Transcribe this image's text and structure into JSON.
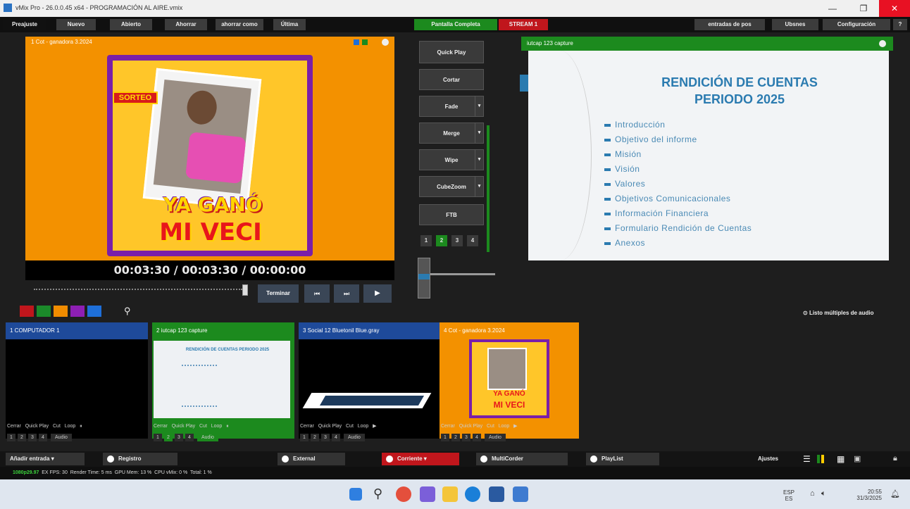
{
  "window": {
    "title": "vMix Pro - 26.0.0.45 x64 - PROGRAMACIÓN AL AIRE.vmix",
    "minimize": "—",
    "maximize": "❐",
    "close": "✕"
  },
  "menu": {
    "items": [
      "Preajuste",
      "Nuevo",
      "Abierto",
      "Ahorrar",
      "ahorrar como",
      "Última"
    ],
    "output_label": "Pantalla Completa",
    "stream_label": "STREAM 1",
    "right_items": [
      "entradas de pos",
      "Ubsnes",
      "Configuración",
      "?"
    ]
  },
  "preview": {
    "title": "1   Cot - ganadora 3.2024",
    "time": "00:03:30 / 00:03:30 / 00:00:00",
    "artwork_text": [
      "YA GANÓ",
      "MI VECI"
    ],
    "sorteo": "SORTEO",
    "play_label": "Terminar",
    "buttons": [
      "⏮",
      "⏭",
      "▶"
    ]
  },
  "transitions": {
    "quick_play": "Quick Play",
    "cut": "Cortar",
    "buttons": [
      "Fade",
      "Merge",
      "Wipe",
      "CubeZoom",
      "FTB"
    ],
    "numbers": [
      "1",
      "2",
      "3",
      "4"
    ]
  },
  "output": {
    "title": "iutcap 123 capture",
    "slide_title": [
      "RENDICIÓN DE CUENTAS",
      "PERIODO 2025"
    ],
    "bullets": [
      "Introducción",
      "Objetivo del informe",
      "Misión",
      "Visión",
      "Valores",
      "Objetivos Comunicacionales",
      "Información Financiera",
      "Formulario Rendición de Cuentas",
      "Anexos"
    ]
  },
  "audio_label": "Listo múltiples de audio",
  "colors": {
    "red": "#c0161c",
    "green": "#1b8a2a",
    "orange": "#f08c00",
    "purple": "#8e1fb4",
    "blue": "#1e6fd9",
    "accent_green": "#1c8a1e",
    "accent_orange": "#f39100",
    "blue_header": "#1e4a9a"
  },
  "inputs": [
    {
      "title": "1   COMPUTADOR 1",
      "controls": [
        "Cerrar",
        "Quick Play",
        "Cut",
        "Loop",
        "⏸"
      ],
      "numbers": [
        "1",
        "2",
        "3",
        "4"
      ],
      "audio": "Audio"
    },
    {
      "title": "2   iutcap 123 capture",
      "controls": [
        "Cerrar",
        "Quick Play",
        "Cut",
        "Loop",
        "⏸"
      ],
      "numbers": [
        "1",
        "2",
        "3",
        "4"
      ],
      "audio": "Audio",
      "mini_title": "RENDICIÓN DE CUENTAS PERIODO 2025"
    },
    {
      "title": "3   Social 12 Bluetonil Blue.gray",
      "controls": [
        "Cerrar",
        "Quick Play",
        "Cut",
        "Loop",
        "▶"
      ],
      "numbers": [
        "1",
        "2",
        "3",
        "4"
      ],
      "audio": "Audio"
    },
    {
      "title": "4   Cot - ganadora 3.2024",
      "controls": [
        "Cerrar",
        "Quick Play",
        "Cut",
        "Loop",
        "▶"
      ],
      "numbers": [
        "1",
        "2",
        "3",
        "4"
      ],
      "audio": "Audio",
      "mini_text": [
        "YA GANÓ",
        "MI VECI"
      ]
    }
  ],
  "bottom": {
    "add_input": "Añadir entrada",
    "record": "Registro",
    "external": "External",
    "stream": "Corriente",
    "multicorder": "MultiCorder",
    "playlist": "PlayList",
    "layout": "Ajustes"
  },
  "status": {
    "resolution": "1080p29.97",
    "fps": "EX FPS: 30",
    "render": "Render Time: 5 ms",
    "gpu": "GPU Mem: 13 %",
    "cpu": "CPU vMix: 0 %",
    "total": "Total: 1 %"
  },
  "taskbar": {
    "lang": "ESP",
    "lang2": "ES",
    "time": "20:55",
    "date": "31/3/2025"
  }
}
